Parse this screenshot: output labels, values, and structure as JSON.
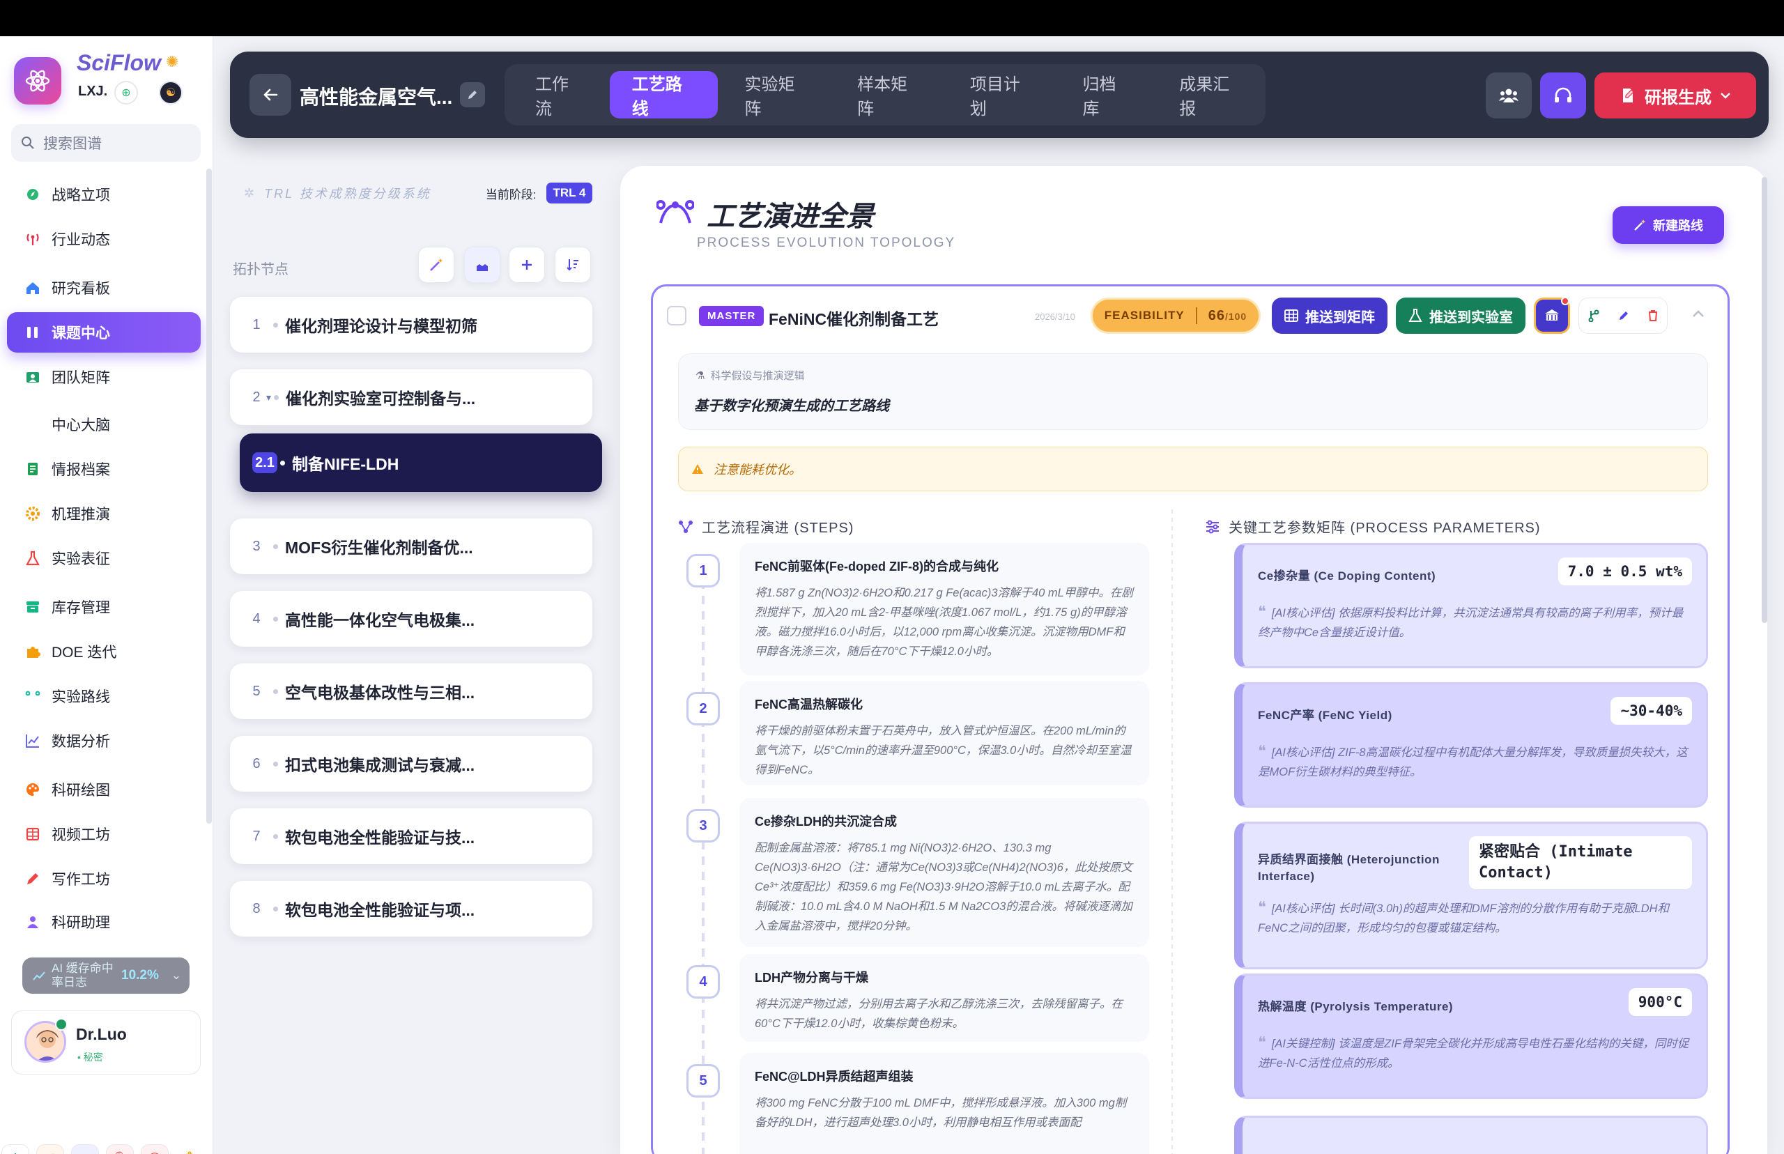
{
  "sidebar": {
    "brand": "SciFlow",
    "brand_sub": "LXJ.",
    "search_placeholder": "搜索图谱",
    "items": [
      {
        "label": "战略立项",
        "icon": "compass-icon",
        "color": "#2bb673"
      },
      {
        "label": "行业动态",
        "icon": "broadcast-icon",
        "color": "#e2314f"
      },
      {
        "label": "研究看板",
        "icon": "home-icon",
        "color": "#3b82f6"
      },
      {
        "label": "课题中心",
        "icon": "columns-icon",
        "color": "#ffffff"
      },
      {
        "label": "团队矩阵",
        "icon": "team-icon",
        "color": "#22a06b"
      },
      {
        "label": "中心大脑",
        "icon": "brain-icon",
        "color": "#a855f7"
      },
      {
        "label": "情报档案",
        "icon": "archive-icon",
        "color": "#1f9d55"
      },
      {
        "label": "机理推演",
        "icon": "gear-icon",
        "color": "#f59e0b"
      },
      {
        "label": "实验表征",
        "icon": "flask-icon",
        "color": "#ef4444"
      },
      {
        "label": "库存管理",
        "icon": "inventory-icon",
        "color": "#10b981"
      },
      {
        "label": "DOE 迭代",
        "icon": "puzzle-icon",
        "color": "#f59e0b"
      },
      {
        "label": "实验路线",
        "icon": "route-icon",
        "color": "#14b8a6"
      },
      {
        "label": "数据分析",
        "icon": "chart-icon",
        "color": "#6366f1"
      },
      {
        "label": "科研绘图",
        "icon": "palette-icon",
        "color": "#f97316"
      },
      {
        "label": "视频工坊",
        "icon": "film-icon",
        "color": "#ef4444"
      },
      {
        "label": "写作工坊",
        "icon": "pen-icon",
        "color": "#ef4444"
      },
      {
        "label": "科研助理",
        "icon": "assistant-icon",
        "color": "#8b5cf6"
      }
    ],
    "cache_label": "AI 缓存命中率日志",
    "cache_value": "10.2%",
    "user_name": "Dr.Luo",
    "user_sub": "• 秘密"
  },
  "header": {
    "project_title": "高性能金属空气...",
    "tabs": [
      "工作流",
      "工艺路线",
      "实验矩阵",
      "样本矩阵",
      "项目计划",
      "归档库",
      "成果汇报"
    ],
    "active_tab": "工艺路线",
    "generate_label": "研报生成"
  },
  "trl": {
    "title": "TRL 技术成熟度分级系统",
    "stage_label": "当前阶段:",
    "stage_value": "TRL 4"
  },
  "topology": {
    "label": "拓扑节点",
    "nodes": [
      {
        "num": "1",
        "text": "催化剂理论设计与模型初筛"
      },
      {
        "num": "2",
        "text": "催化剂实验室可控制备与..."
      },
      {
        "num": "2.1",
        "text": "制备NIFE-LDH"
      },
      {
        "num": "3",
        "text": "MOFS衍生催化剂制备优..."
      },
      {
        "num": "4",
        "text": "高性能一体化空气电极集..."
      },
      {
        "num": "5",
        "text": "空气电极基体改性与三相..."
      },
      {
        "num": "6",
        "text": "扣式电池集成测试与衰减..."
      },
      {
        "num": "7",
        "text": "软包电池全性能验证与技..."
      },
      {
        "num": "8",
        "text": "软包电池全性能验证与项..."
      }
    ]
  },
  "main": {
    "title": "工艺演进全景",
    "subtitle": "PROCESS EVOLUTION TOPOLOGY",
    "new_route": "新建路线",
    "route": {
      "badge": "MASTER",
      "name": "FeNiNC催化剂制备工艺",
      "date": "2026/3/10",
      "feasibility_label": "FEASIBILITY",
      "feasibility_score": "66",
      "feasibility_max": "/100",
      "push_matrix": "推送到矩阵",
      "push_lab": "推送到实验室",
      "hypothesis_label": "科学假设与推演逻辑",
      "hypothesis_text": "基于数字化预演生成的工艺路线",
      "warning": "注意能耗优化。",
      "steps_title": "工艺流程演进 (STEPS)",
      "params_title": "关键工艺参数矩阵 (PROCESS PARAMETERS)",
      "steps": [
        {
          "num": "1",
          "title": "FeNC前驱体(Fe-doped ZIF-8)的合成与纯化",
          "body": "将1.587 g Zn(NO3)2·6H2O和0.217 g Fe(acac)3溶解于40 mL甲醇中。在剧烈搅拌下，加入20 mL含2-甲基咪唑(浓度1.067 mol/L，约1.75 g)的甲醇溶液。磁力搅拌16.0小时后，以12,000 rpm离心收集沉淀。沉淀物用DMF和甲醇各洗涤三次，随后在70°C下干燥12.0小时。"
        },
        {
          "num": "2",
          "title": "FeNC高温热解碳化",
          "body": "将干燥的前驱体粉末置于石英舟中，放入管式炉恒温区。在200 mL/min的氩气流下，以5°C/min的速率升温至900°C，保温3.0小时。自然冷却至室温得到FeNC。"
        },
        {
          "num": "3",
          "title": "Ce掺杂LDH的共沉淀合成",
          "body": "配制金属盐溶液：将785.1 mg Ni(NO3)2·6H2O、130.3 mg Ce(NO3)3·6H2O（注：通常为Ce(NO3)3或Ce(NH4)2(NO3)6，此处按原文Ce³⁺浓度配比）和359.6 mg Fe(NO3)3·9H2O溶解于10.0 mL去离子水。配制碱液：10.0 mL含4.0 M NaOH和1.5 M Na2CO3的混合液。将碱液逐滴加入金属盐溶液中，搅拌20分钟。"
        },
        {
          "num": "4",
          "title": "LDH产物分离与干燥",
          "body": "将共沉淀产物过滤，分别用去离子水和乙醇洗涤三次，去除残留离子。在60°C下干燥12.0小时，收集棕黄色粉末。"
        },
        {
          "num": "5",
          "title": "FeNC@LDH异质结超声组装",
          "body": "将300 mg FeNC分散于100 mL DMF中，搅拌形成悬浮液。加入300 mg制备好的LDH，进行超声处理3.0小时，利用静电相互作用或表面配"
        }
      ],
      "params": [
        {
          "name": "Ce掺杂量 (Ce Doping Content)",
          "value": "7.0 ± 0.5 wt%",
          "note": "[AI核心评估] 依据原料投料比计算，共沉淀法通常具有较高的离子利用率，预计最终产物中Ce含量接近设计值。"
        },
        {
          "name": "FeNC产率 (FeNC Yield)",
          "value": "~30-40%",
          "note": "[AI核心评估] ZIF-8高温碳化过程中有机配体大量分解挥发，导致质量损失较大，这是MOF衍生碳材料的典型特征。"
        },
        {
          "name": "异质结界面接触 (Heterojunction Interface)",
          "value": "紧密贴合 (Intimate Contact)",
          "note": "[AI核心评估] 长时间(3.0h)的超声处理和DMF溶剂的分散作用有助于克服LDH和FeNC之间的团聚，形成均匀的包覆或锚定结构。"
        },
        {
          "name": "热解温度 (Pyrolysis Temperature)",
          "value": "900°C",
          "note": "[AI关键控制] 该温度是ZIF骨架完全碳化并形成高导电性石墨化结构的关键，同时促进Fe-N-C活性位点的形成。"
        }
      ]
    }
  }
}
